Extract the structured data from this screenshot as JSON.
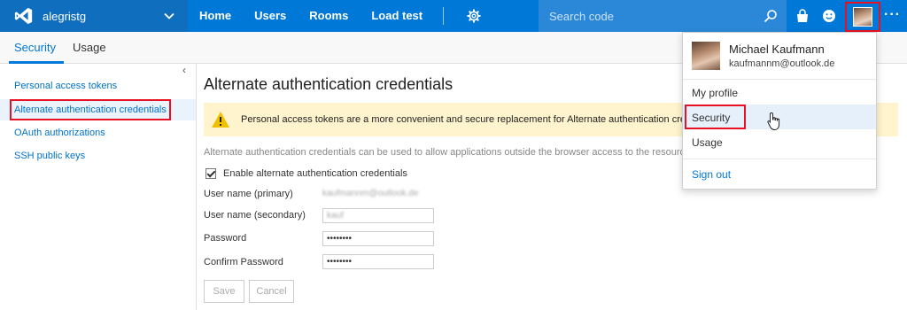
{
  "header": {
    "account": "alegristg",
    "nav": [
      "Home",
      "Users",
      "Rooms",
      "Load test"
    ],
    "search_placeholder": "Search code"
  },
  "subtabs": [
    "Security",
    "Usage"
  ],
  "sidebar": {
    "collapse_glyph": "‹",
    "items": [
      "Personal access tokens",
      "Alternate authentication credentials",
      "OAuth authorizations",
      "SSH public keys"
    ],
    "selected_index": 1
  },
  "main": {
    "title": "Alternate authentication credentials",
    "warning": "Personal access tokens are a more convenient and secure replacement for Alternate authentication credent",
    "description": "Alternate authentication credentials can be used to allow applications outside the browser access to the resources st",
    "checkbox_label": "Enable alternate authentication credentials",
    "checkbox_checked": true,
    "fields": {
      "primary_label": "User name (primary)",
      "secondary_label": "User name (secondary)",
      "password_label": "Password",
      "password_value": "••••••••",
      "confirm_label": "Confirm Password",
      "confirm_value": "••••••••"
    },
    "buttons": {
      "save": "Save",
      "cancel": "Cancel"
    }
  },
  "profile_menu": {
    "name": "Michael Kaufmann",
    "email": "kaufmannm@outlook.de",
    "items": [
      "My profile",
      "Security",
      "Usage"
    ],
    "signout": "Sign out"
  },
  "colors": {
    "topbar": "#0078d7",
    "account_bg": "#106ebe",
    "highlight_border": "#e81123",
    "warning_bg": "#fff4ce",
    "link": "#0072c6"
  },
  "icons": [
    "vs-logo-icon",
    "chevron-down-icon",
    "gear-icon",
    "search-icon",
    "bag-icon",
    "smiley-icon",
    "avatar-icon",
    "more-icon",
    "warning-icon",
    "cursor-hand-icon"
  ]
}
